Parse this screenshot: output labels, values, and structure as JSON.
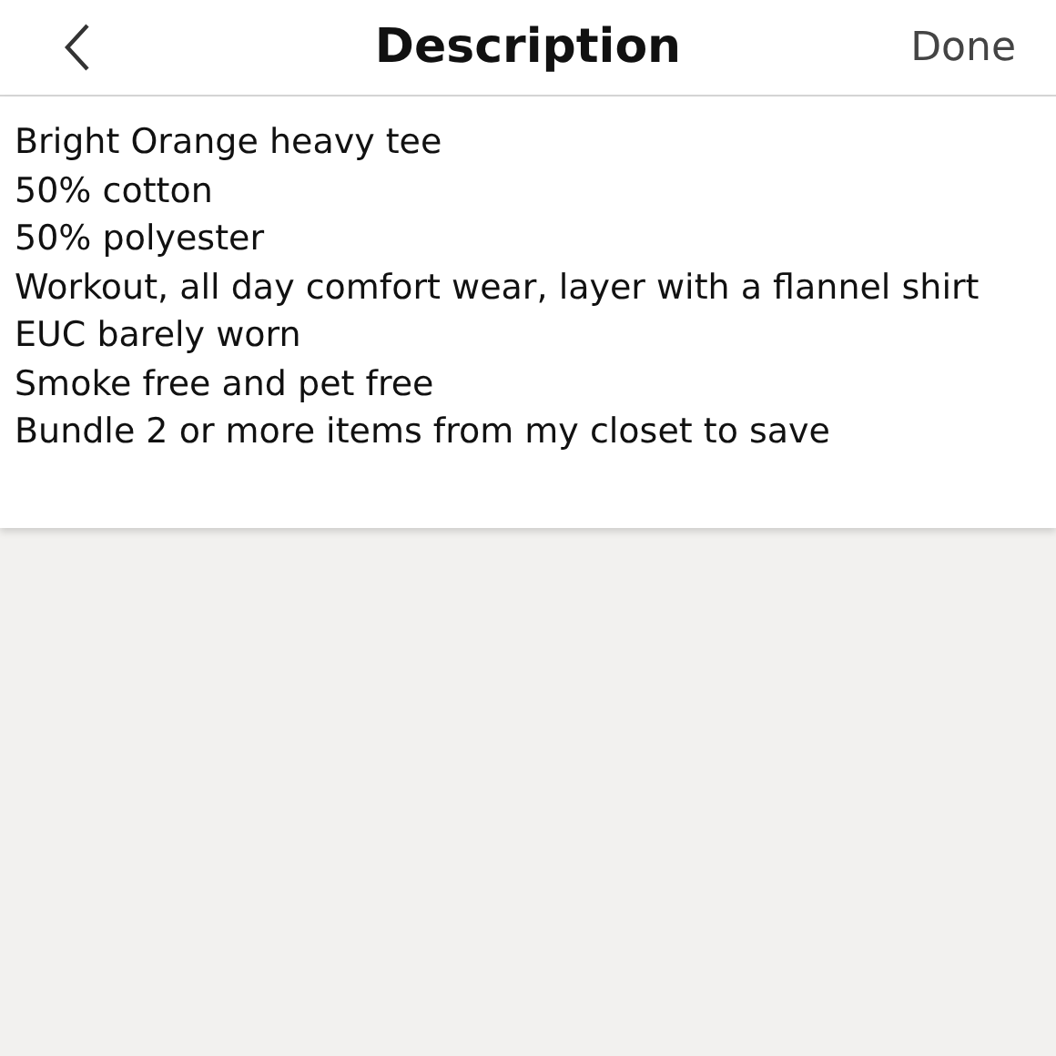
{
  "header": {
    "title": "Description",
    "done_label": "Done"
  },
  "description": {
    "lines": [
      "Bright Orange heavy tee",
      "50% cotton",
      "50% polyester",
      "Workout, all day comfort wear, layer with a flannel shirt",
      "EUC barely worn",
      "Smoke free and pet free",
      "Bundle 2 or more items from my closet to save"
    ]
  }
}
